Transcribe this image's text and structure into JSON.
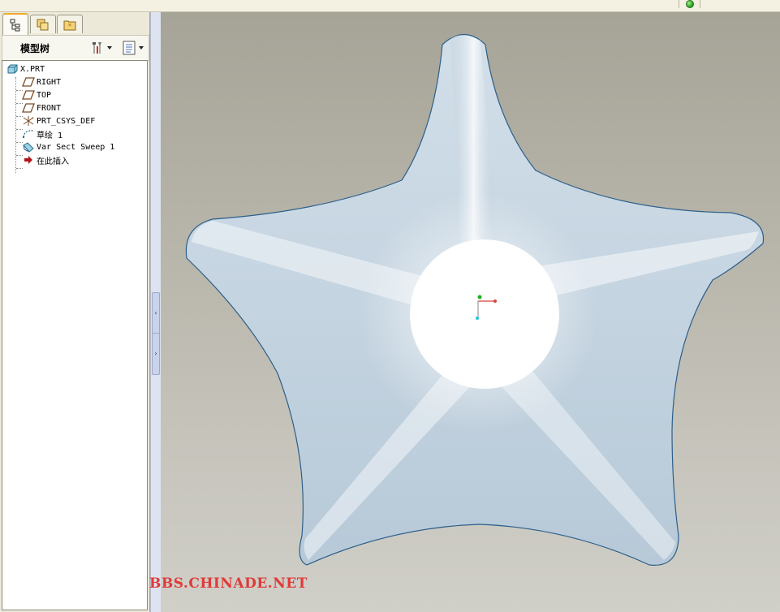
{
  "model_tree": {
    "title": "模型树",
    "items": [
      {
        "label": "X.PRT",
        "icon": "part-icon"
      },
      {
        "label": "RIGHT",
        "icon": "datum-plane-icon"
      },
      {
        "label": "TOP",
        "icon": "datum-plane-icon"
      },
      {
        "label": "FRONT",
        "icon": "datum-plane-icon"
      },
      {
        "label": "PRT_CSYS_DEF",
        "icon": "coordinate-system-icon"
      },
      {
        "label": "草绘 1",
        "icon": "sketch-icon"
      },
      {
        "label": "Var Sect Sweep 1",
        "icon": "var-sect-sweep-icon"
      },
      {
        "label": "在此插入",
        "icon": "insert-here-arrow-icon"
      }
    ]
  },
  "panel_tabs": [
    {
      "icon": "model-tree-tab-icon",
      "active": true
    },
    {
      "icon": "folder-browser-tab-icon",
      "active": false
    },
    {
      "icon": "favorites-tab-icon",
      "active": false
    }
  ],
  "toolbar_icons": [
    "settings-tools-icon",
    "show-options-icon"
  ],
  "splitter": {
    "collapse_glyph": "‹",
    "expand_glyph": "›"
  },
  "watermark": "BBS.CHINADE.NET",
  "colors": {
    "accent_tab": "#f0a830",
    "watermark": "#e03a38",
    "model_surface": "#c9d7e3",
    "status_led": "#1e9a16"
  }
}
